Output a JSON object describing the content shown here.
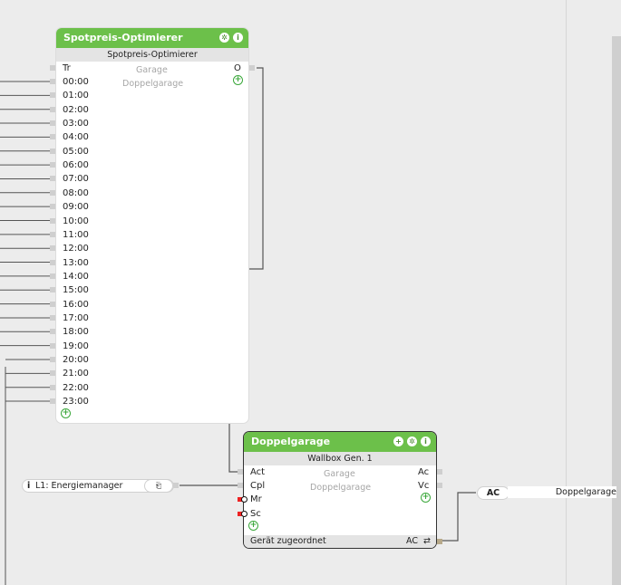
{
  "spot": {
    "title": "Spotpreis-Optimierer",
    "subtitle": "Spotpreis-Optimierer",
    "tr": "Tr",
    "garage": "Garage",
    "doppelgarage": "Doppelgarage",
    "out": "O",
    "hours": [
      "00:00",
      "01:00",
      "02:00",
      "03:00",
      "04:00",
      "05:00",
      "06:00",
      "07:00",
      "08:00",
      "09:00",
      "10:00",
      "11:00",
      "12:00",
      "13:00",
      "14:00",
      "15:00",
      "16:00",
      "17:00",
      "18:00",
      "19:00",
      "20:00",
      "21:00",
      "22:00",
      "23:00"
    ]
  },
  "dg": {
    "title": "Doppelgarage",
    "subtitle": "Wallbox Gen. 1",
    "inputs": [
      "Act",
      "Cpl",
      "Mr",
      "Sc"
    ],
    "garage": "Garage",
    "doppelgarage": "Doppelgarage",
    "ac": "Ac",
    "vc": "Vc",
    "footer_left": "Gerät zugeordnet",
    "footer_right": "AC",
    "footer_symbol": "⇄"
  },
  "energy": {
    "info": "i",
    "label": "L1: Energiemanager"
  },
  "output": {
    "pill": "AC",
    "label": "Doppelgarage"
  },
  "icons": {
    "gear": "✲",
    "info": "i",
    "add": "+",
    "plus_small": "+"
  }
}
